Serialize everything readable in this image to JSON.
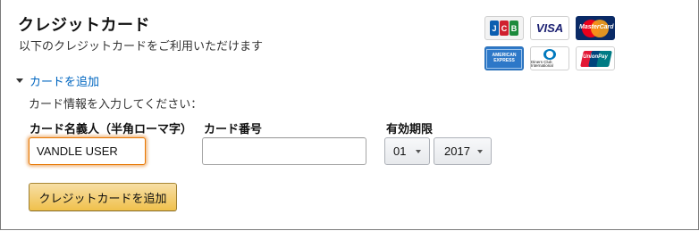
{
  "section": {
    "title": "クレジットカード",
    "subtitle": "以下のクレジットカードをご利用いただけます"
  },
  "card_brands": [
    {
      "name": "JCB",
      "icon": "jcb-logo-icon"
    },
    {
      "name": "VISA",
      "icon": "visa-logo-icon"
    },
    {
      "name": "MasterCard",
      "icon": "mastercard-logo-icon"
    },
    {
      "name": "AMERICAN EXPRESS",
      "icon": "amex-logo-icon"
    },
    {
      "name": "Diners Club International",
      "icon": "diners-logo-icon"
    },
    {
      "name": "UnionPay",
      "icon": "unionpay-logo-icon"
    }
  ],
  "add_card": {
    "toggle_label": "カードを追加",
    "instruction": "カード情報を入力してください：",
    "name_label": "カード名義人（半角ローマ字）",
    "name_value": "VANDLE USER",
    "number_label": "カード番号",
    "number_value": "",
    "expiry_label": "有効期限",
    "month_selected": "01",
    "year_selected": "2017",
    "submit_label": "クレジットカードを追加"
  },
  "colors": {
    "link": "#0066c0",
    "button_gradient_top": "#f7dfa5",
    "button_gradient_bottom": "#f0c14b",
    "focus_border": "#e77600"
  }
}
